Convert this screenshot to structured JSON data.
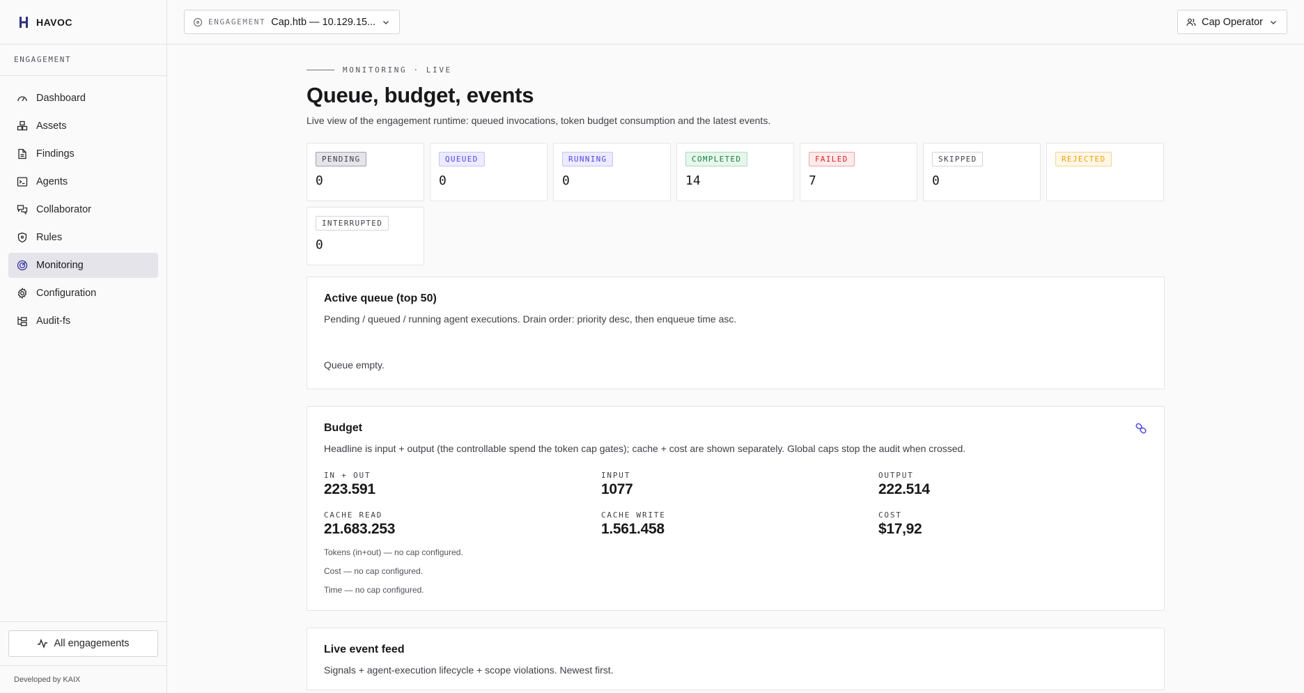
{
  "brand": {
    "name": "HAVOC"
  },
  "sidebar": {
    "section_label": "ENGAGEMENT",
    "items": [
      {
        "label": "Dashboard",
        "icon": "gauge-icon",
        "active": false
      },
      {
        "label": "Assets",
        "icon": "boxes-icon",
        "active": false
      },
      {
        "label": "Findings",
        "icon": "file-icon",
        "active": false
      },
      {
        "label": "Agents",
        "icon": "terminal-icon",
        "active": false
      },
      {
        "label": "Collaborator",
        "icon": "messages-icon",
        "active": false
      },
      {
        "label": "Rules",
        "icon": "shield-icon",
        "active": false
      },
      {
        "label": "Monitoring",
        "icon": "radar-icon",
        "active": true
      },
      {
        "label": "Configuration",
        "icon": "gear-icon",
        "active": false
      },
      {
        "label": "Audit-fs",
        "icon": "folder-tree-icon",
        "active": false
      }
    ],
    "all_engagements": "All engagements",
    "footer": "Developed by KAIX"
  },
  "topbar": {
    "engagement_label": "ENGAGEMENT",
    "engagement_value": "Cap.htb — 10.129.15...",
    "user": "Cap Operator"
  },
  "page": {
    "kicker": "MONITORING · LIVE",
    "title": "Queue, budget, events",
    "subtitle": "Live view of the engagement runtime: queued invocations, token budget consumption and the latest events."
  },
  "stats": [
    {
      "label": "PENDING",
      "value": "0",
      "fg": "#3f3f46",
      "bg": "#e4e4ea",
      "border": "#a1a1aa"
    },
    {
      "label": "QUEUED",
      "value": "0",
      "fg": "#4f46e5",
      "bg": "#ecebff",
      "border": "#c7c4f5"
    },
    {
      "label": "RUNNING",
      "value": "0",
      "fg": "#4f46e5",
      "bg": "#ecebff",
      "border": "#c7c4f5"
    },
    {
      "label": "COMPLETED",
      "value": "14",
      "fg": "#15803d",
      "bg": "#e7f6ec",
      "border": "#a7dcb8"
    },
    {
      "label": "FAILED",
      "value": "7",
      "fg": "#dc2626",
      "bg": "#fdeaea",
      "border": "#f1a5a5"
    },
    {
      "label": "SKIPPED",
      "value": "0",
      "fg": "#3f3f46",
      "bg": "#ffffff",
      "border": "#d4d4d8"
    },
    {
      "label": "REJECTED",
      "value": "",
      "fg": "#f59e0b",
      "bg": "#fff7e6",
      "border": "#f8d491"
    },
    {
      "label": "INTERRUPTED",
      "value": "0",
      "fg": "#3f3f46",
      "bg": "#ffffff",
      "border": "#d4d4d8"
    }
  ],
  "queue": {
    "title": "Active queue (top 50)",
    "desc": "Pending / queued / running agent executions. Drain order: priority desc, then enqueue time asc.",
    "empty": "Queue empty."
  },
  "budget": {
    "title": "Budget",
    "desc": "Headline is input + output (the controllable spend the token cap gates); cache + cost are shown separately. Global caps stop the audit when crossed.",
    "icon": "link-icon",
    "metrics": [
      {
        "label": "IN + OUT",
        "value": "223.591"
      },
      {
        "label": "INPUT",
        "value": "1077"
      },
      {
        "label": "OUTPUT",
        "value": "222.514"
      },
      {
        "label": "CACHE READ",
        "value": "21.683.253"
      },
      {
        "label": "CACHE WRITE",
        "value": "1.561.458"
      },
      {
        "label": "COST",
        "value": "$17,92"
      }
    ],
    "notes": [
      "Tokens (in+out) — no cap configured.",
      "Cost — no cap configured.",
      "Time — no cap configured."
    ]
  },
  "events": {
    "title": "Live event feed",
    "desc": "Signals + agent-execution lifecycle + scope violations. Newest first."
  },
  "colors": {
    "accent": "#4f46e5",
    "active_nav": "#e4e4ea"
  }
}
